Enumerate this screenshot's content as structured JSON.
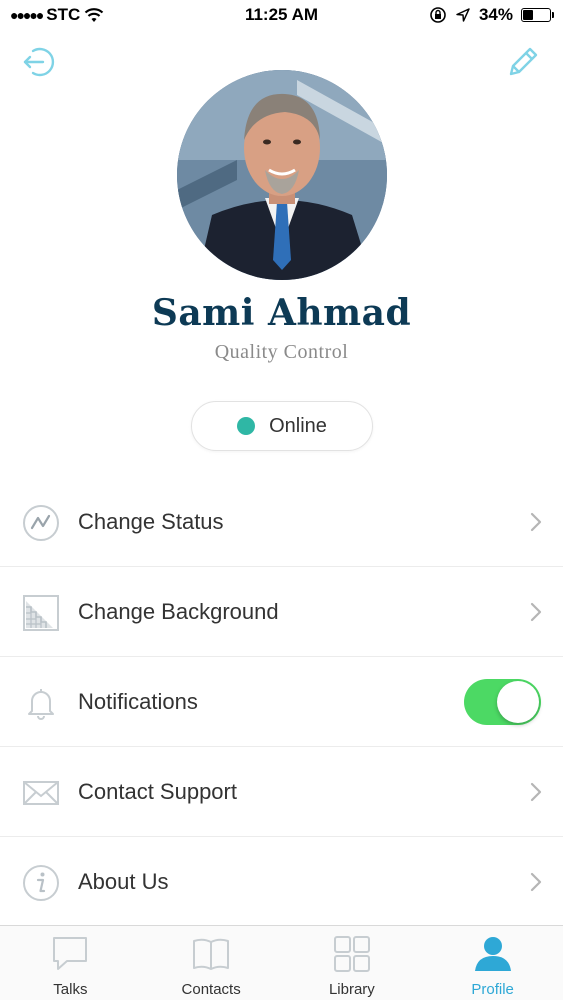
{
  "status_bar": {
    "signal_dots": "●●●●●",
    "carrier": "STC",
    "time": "11:25 AM",
    "battery_percent": "34%",
    "battery_level": 0.34
  },
  "header": {
    "left_icon": "logout-icon",
    "right_icon": "edit-icon"
  },
  "profile": {
    "name": "Sami Ahmad",
    "role": "Quality Control",
    "avatar": "profile-photo"
  },
  "status": {
    "label": "Online",
    "color": "#2fb7a5"
  },
  "menu": [
    {
      "label": "Change Status",
      "icon": "status-icon",
      "control": "chevron"
    },
    {
      "label": "Change Background",
      "icon": "background-icon",
      "control": "chevron"
    },
    {
      "label": "Notifications",
      "icon": "bell-icon",
      "control": "toggle",
      "enabled": true
    },
    {
      "label": "Contact Support",
      "icon": "envelope-icon",
      "control": "chevron"
    },
    {
      "label": "About Us",
      "icon": "info-icon",
      "control": "chevron"
    }
  ],
  "tabs": [
    {
      "label": "Talks",
      "icon": "chat-bubble-icon",
      "active": false
    },
    {
      "label": "Contacts",
      "icon": "book-icon",
      "active": false
    },
    {
      "label": "Library",
      "icon": "grid-icon",
      "active": false
    },
    {
      "label": "Profile",
      "icon": "person-icon",
      "active": true
    }
  ],
  "colors": {
    "accent": "#2ea8d6",
    "name": "#0d3a55",
    "toggle_on": "#4cd964",
    "icon_gray": "#c7cdd1"
  }
}
